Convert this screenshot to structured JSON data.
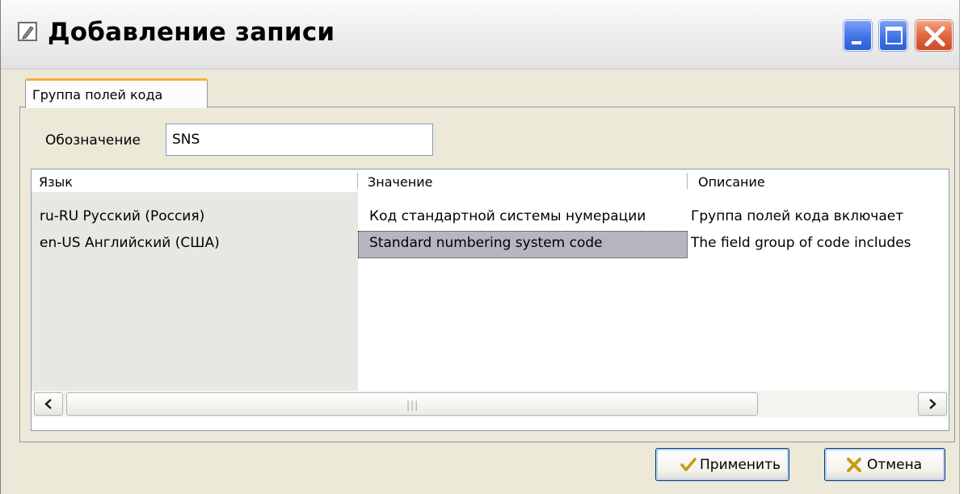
{
  "window": {
    "title": "Добавление записи"
  },
  "tabs": [
    {
      "label": "Группа полей кода",
      "active": true
    }
  ],
  "form": {
    "designation_label": "Обозначение",
    "designation_value": "SNS"
  },
  "grid": {
    "columns": [
      "Язык",
      "Значение",
      "Описание"
    ],
    "rows": [
      {
        "lang": "ru-RU  Русский (Россия)",
        "value": "Код стандартной системы нумерации",
        "description": "Группа полей кода включает"
      },
      {
        "lang": "en-US  Английский (США)",
        "value": "Standard numbering system code",
        "description": "The field group of code includes"
      }
    ],
    "selected_row": 1,
    "selected_column": "Значение"
  },
  "buttons": {
    "apply_label": "Применить",
    "cancel_label": "Отмена"
  },
  "icons": {
    "title": "edit-record-icon",
    "minimize": "minimize-icon",
    "maximize": "maximize-icon",
    "close": "close-icon",
    "apply": "checkmark-icon",
    "cancel": "cross-icon",
    "scroll_left": "arrow-left-icon",
    "scroll_right": "arrow-right-icon"
  },
  "colors": {
    "titlebar_button_blue": "#3f73e7",
    "close_button_red": "#e0683f",
    "tab_highlight": "#f5b03e",
    "selection": "#b6b6c0",
    "window_bg": "#ece9d8"
  }
}
